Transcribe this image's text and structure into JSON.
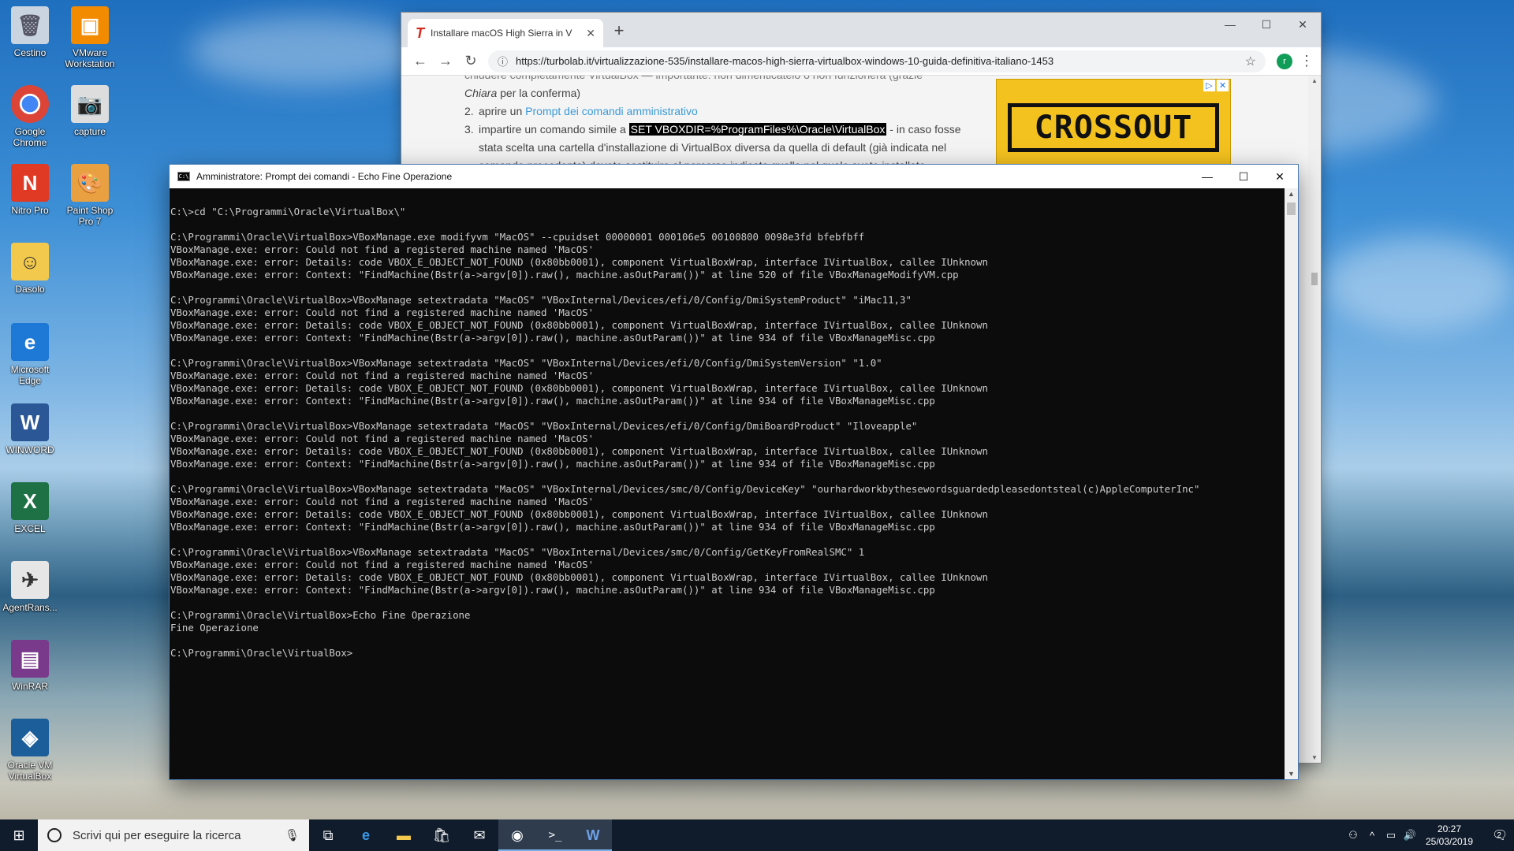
{
  "desktop": {
    "icons": [
      {
        "label": "Cestino",
        "icon": "recycle-bin-icon"
      },
      {
        "label": "VMware Workstation",
        "icon": "vmware-icon"
      },
      {
        "label": "Google Chrome",
        "icon": "chrome-icon"
      },
      {
        "label": "capture",
        "icon": "capture-icon"
      },
      {
        "label": "Nitro Pro",
        "icon": "nitro-icon"
      },
      {
        "label": "Paint Shop Pro 7",
        "icon": "paintshop-icon"
      },
      {
        "label": "Dasolo",
        "icon": "user-folder-icon"
      },
      {
        "label": "Microsoft Edge",
        "icon": "edge-icon"
      },
      {
        "label": "WINWORD",
        "icon": "word-icon"
      },
      {
        "label": "EXCEL",
        "icon": "excel-icon"
      },
      {
        "label": "AgentRans...",
        "icon": "agent-icon"
      },
      {
        "label": "WinRAR",
        "icon": "winrar-icon"
      },
      {
        "label": "Oracle VM VirtualBox",
        "icon": "virtualbox-icon"
      }
    ]
  },
  "browser": {
    "tab_title": "Installare macOS High Sierra in V",
    "url": "https://turbolab.it/virtualizzazione-535/installare-macos-high-sierra-virtualbox-windows-10-guida-definitiva-italiano-1453",
    "avatar_letter": "r",
    "article": {
      "line_top": "chiudere completamente VirtualBox — importante: non dimenticatelo o non funzionerà (grazie",
      "line_top_b_italic": "Chiara",
      "line_top_b_rest": " per la conferma)",
      "step2_num": "2.",
      "step2_prefix": "aprire un ",
      "step2_link": "Prompt dei comandi amministrativo",
      "step3_num": "3.",
      "step3_prefix": "impartire un comando simile a ",
      "step3_highlight": "SET VBOXDIR=%ProgramFiles%\\Oracle\\VirtualBox",
      "step3_suffix": " - in caso fosse",
      "step3_line2": "stata scelta una cartella d'installazione di VirtualBox diversa da quella di default (già indicata nel",
      "step3_line3": "comando precedente) dovete sostituire al percorso indicato quello nel quale avete installato"
    },
    "ad": {
      "brand": "CROSSOUT"
    }
  },
  "cmd": {
    "title": "Amministratore: Prompt dei comandi - Echo  Fine Operazione",
    "lines": [
      "",
      "C:\\>cd \"C:\\Programmi\\Oracle\\VirtualBox\\\"",
      "",
      "C:\\Programmi\\Oracle\\VirtualBox>VBoxManage.exe modifyvm \"MacOS\" --cpuidset 00000001 000106e5 00100800 0098e3fd bfebfbff",
      "VBoxManage.exe: error: Could not find a registered machine named 'MacOS'",
      "VBoxManage.exe: error: Details: code VBOX_E_OBJECT_NOT_FOUND (0x80bb0001), component VirtualBoxWrap, interface IVirtualBox, callee IUnknown",
      "VBoxManage.exe: error: Context: \"FindMachine(Bstr(a->argv[0]).raw(), machine.asOutParam())\" at line 520 of file VBoxManageModifyVM.cpp",
      "",
      "C:\\Programmi\\Oracle\\VirtualBox>VBoxManage setextradata \"MacOS\" \"VBoxInternal/Devices/efi/0/Config/DmiSystemProduct\" \"iMac11,3\"",
      "VBoxManage.exe: error: Could not find a registered machine named 'MacOS'",
      "VBoxManage.exe: error: Details: code VBOX_E_OBJECT_NOT_FOUND (0x80bb0001), component VirtualBoxWrap, interface IVirtualBox, callee IUnknown",
      "VBoxManage.exe: error: Context: \"FindMachine(Bstr(a->argv[0]).raw(), machine.asOutParam())\" at line 934 of file VBoxManageMisc.cpp",
      "",
      "C:\\Programmi\\Oracle\\VirtualBox>VBoxManage setextradata \"MacOS\" \"VBoxInternal/Devices/efi/0/Config/DmiSystemVersion\" \"1.0\"",
      "VBoxManage.exe: error: Could not find a registered machine named 'MacOS'",
      "VBoxManage.exe: error: Details: code VBOX_E_OBJECT_NOT_FOUND (0x80bb0001), component VirtualBoxWrap, interface IVirtualBox, callee IUnknown",
      "VBoxManage.exe: error: Context: \"FindMachine(Bstr(a->argv[0]).raw(), machine.asOutParam())\" at line 934 of file VBoxManageMisc.cpp",
      "",
      "C:\\Programmi\\Oracle\\VirtualBox>VBoxManage setextradata \"MacOS\" \"VBoxInternal/Devices/efi/0/Config/DmiBoardProduct\" \"Iloveapple\"",
      "VBoxManage.exe: error: Could not find a registered machine named 'MacOS'",
      "VBoxManage.exe: error: Details: code VBOX_E_OBJECT_NOT_FOUND (0x80bb0001), component VirtualBoxWrap, interface IVirtualBox, callee IUnknown",
      "VBoxManage.exe: error: Context: \"FindMachine(Bstr(a->argv[0]).raw(), machine.asOutParam())\" at line 934 of file VBoxManageMisc.cpp",
      "",
      "C:\\Programmi\\Oracle\\VirtualBox>VBoxManage setextradata \"MacOS\" \"VBoxInternal/Devices/smc/0/Config/DeviceKey\" \"ourhardworkbythesewordsguardedpleasedontsteal(c)AppleComputerInc\"",
      "VBoxManage.exe: error: Could not find a registered machine named 'MacOS'",
      "VBoxManage.exe: error: Details: code VBOX_E_OBJECT_NOT_FOUND (0x80bb0001), component VirtualBoxWrap, interface IVirtualBox, callee IUnknown",
      "VBoxManage.exe: error: Context: \"FindMachine(Bstr(a->argv[0]).raw(), machine.asOutParam())\" at line 934 of file VBoxManageMisc.cpp",
      "",
      "C:\\Programmi\\Oracle\\VirtualBox>VBoxManage setextradata \"MacOS\" \"VBoxInternal/Devices/smc/0/Config/GetKeyFromRealSMC\" 1",
      "VBoxManage.exe: error: Could not find a registered machine named 'MacOS'",
      "VBoxManage.exe: error: Details: code VBOX_E_OBJECT_NOT_FOUND (0x80bb0001), component VirtualBoxWrap, interface IVirtualBox, callee IUnknown",
      "VBoxManage.exe: error: Context: \"FindMachine(Bstr(a->argv[0]).raw(), machine.asOutParam())\" at line 934 of file VBoxManageMisc.cpp",
      "",
      "C:\\Programmi\\Oracle\\VirtualBox>Echo Fine Operazione",
      "Fine Operazione",
      "",
      "C:\\Programmi\\Oracle\\VirtualBox>"
    ]
  },
  "taskbar": {
    "search_placeholder": "Scrivi qui per eseguire la ricerca",
    "apps": [
      "task-view-icon",
      "edge-icon",
      "file-explorer-icon",
      "store-icon",
      "mail-icon",
      "chrome-icon",
      "cmd-icon",
      "word-icon"
    ],
    "time": "20:27",
    "date": "25/03/2019",
    "notification_count": "2"
  }
}
